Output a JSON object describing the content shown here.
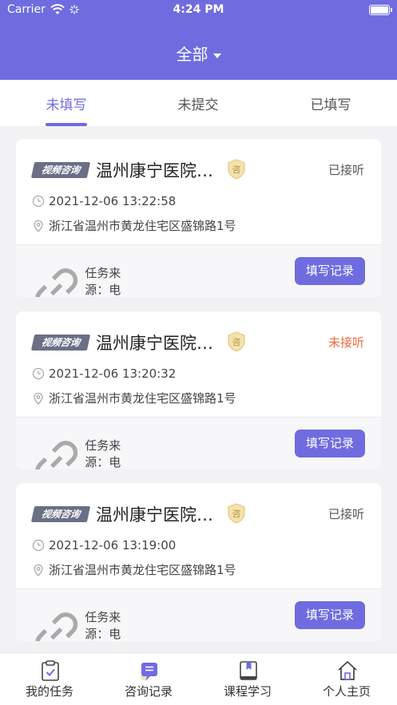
{
  "status_bar": {
    "carrier": "Carrier",
    "time": "4:24 PM"
  },
  "header": {
    "title": "全部"
  },
  "tabs": [
    {
      "label": "未填写"
    },
    {
      "label": "未提交"
    },
    {
      "label": "已填写"
    }
  ],
  "cards": [
    {
      "tag": "视频咨询",
      "hospital": "温州康宁医院…",
      "badge": "咨",
      "status": "已接听",
      "time": "2021-12-06 13:22:58",
      "address": "浙江省温州市黄龙住宅区盛锦路1号",
      "source": "任务来源：电话亭",
      "button": "填写记录"
    },
    {
      "tag": "视频咨询",
      "hospital": "温州康宁医院…",
      "badge": "咨",
      "status": "未接听",
      "time": "2021-12-06 13:20:32",
      "address": "浙江省温州市黄龙住宅区盛锦路1号",
      "source": "任务来源：电话亭",
      "button": "填写记录"
    },
    {
      "tag": "视频咨询",
      "hospital": "温州康宁医院…",
      "badge": "咨",
      "status": "已接听",
      "time": "2021-12-06 13:19:00",
      "address": "浙江省温州市黄龙住宅区盛锦路1号",
      "source": "任务来源：电话亭",
      "button": "填写记录"
    }
  ],
  "tabbar": [
    {
      "label": "我的任务",
      "icon": "clipboard-check-icon"
    },
    {
      "label": "咨询记录",
      "icon": "chat-list-icon"
    },
    {
      "label": "课程学习",
      "icon": "book-icon"
    },
    {
      "label": "个人主页",
      "icon": "home-icon"
    }
  ],
  "colors": {
    "accent": "#6f6ce0",
    "missed": "#f06a3b",
    "badge_gold": "#e6c77a"
  }
}
